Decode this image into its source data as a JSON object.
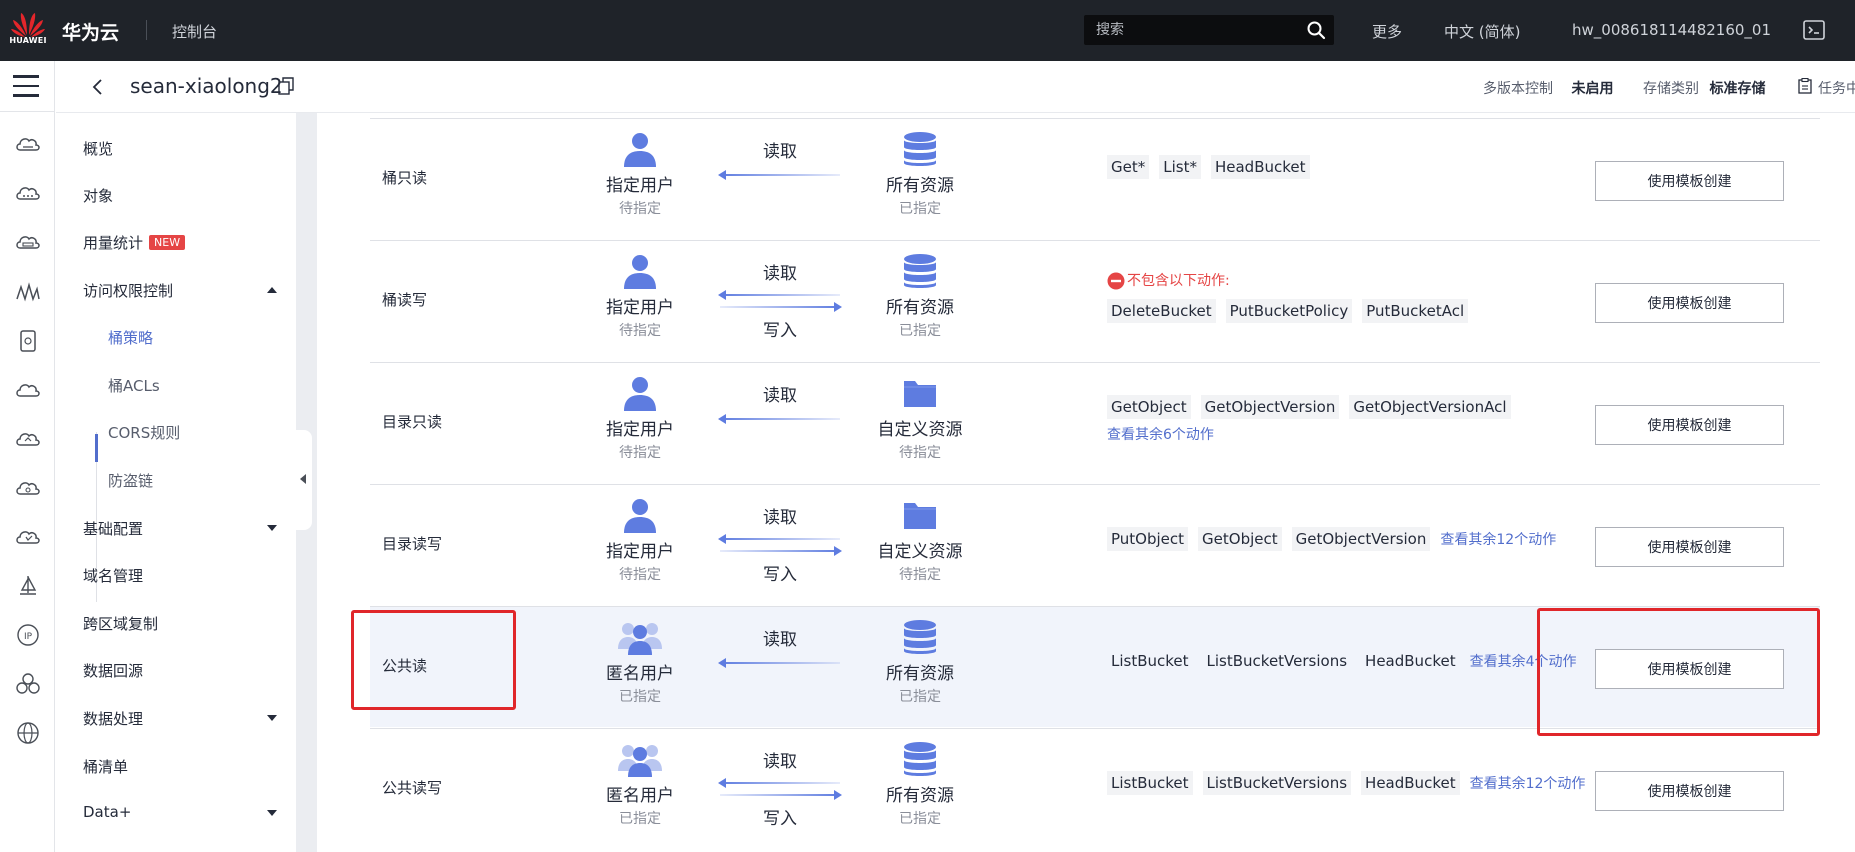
{
  "topbar": {
    "logo_text": "HUAWEI",
    "brand": "华为云",
    "console": "控制台",
    "search_placeholder": "搜索",
    "more": "更多",
    "language": "中文 (简体)",
    "account": "hw_008618114482160_01"
  },
  "header": {
    "bucket_name": "sean-xiaolong2",
    "versioning_label": "多版本控制",
    "versioning_value": "未启用",
    "storage_label": "存储类别",
    "storage_value": "标准存储",
    "task_label": "任务中"
  },
  "nav": {
    "overview": "概览",
    "objects": "对象",
    "usage": "用量统计",
    "usage_badge": "NEW",
    "access_control": "访问权限控制",
    "bucket_policy": "桶策略",
    "bucket_acls": "桶ACLs",
    "cors": "CORS规则",
    "hotlink": "防盗链",
    "basic_config": "基础配置",
    "domain": "域名管理",
    "cross_region": "跨区域复制",
    "back_to_source": "数据回源",
    "data_processing": "数据处理",
    "inventory": "桶清单",
    "data_plus": "Data+"
  },
  "rows": [
    {
      "name": "桶只读",
      "principal": "指定用户",
      "principal_status": "待指定",
      "read_label": "读取",
      "write_label": "",
      "resource": "所有资源",
      "resource_status": "已指定",
      "exclude_text": "",
      "tags": [
        "Get*",
        "List*",
        "HeadBucket"
      ],
      "more": "",
      "button": "使用模板创建"
    },
    {
      "name": "桶读写",
      "principal": "指定用户",
      "principal_status": "待指定",
      "read_label": "读取",
      "write_label": "写入",
      "resource": "所有资源",
      "resource_status": "已指定",
      "exclude_text": "不包含以下动作:",
      "tags": [
        "DeleteBucket",
        "PutBucketPolicy",
        "PutBucketAcl"
      ],
      "more": "",
      "button": "使用模板创建"
    },
    {
      "name": "目录只读",
      "principal": "指定用户",
      "principal_status": "待指定",
      "read_label": "读取",
      "write_label": "",
      "resource": "自定义资源",
      "resource_status": "待指定",
      "exclude_text": "",
      "tags": [
        "GetObject",
        "GetObjectVersion",
        "GetObjectVersionAcl"
      ],
      "more": "查看其余6个动作",
      "button": "使用模板创建"
    },
    {
      "name": "目录读写",
      "principal": "指定用户",
      "principal_status": "待指定",
      "read_label": "读取",
      "write_label": "写入",
      "resource": "自定义资源",
      "resource_status": "待指定",
      "exclude_text": "",
      "tags": [
        "PutObject",
        "GetObject",
        "GetObjectVersion"
      ],
      "more": "查看其余12个动作",
      "button": "使用模板创建"
    },
    {
      "name": "公共读",
      "principal": "匿名用户",
      "principal_status": "已指定",
      "read_label": "读取",
      "write_label": "",
      "resource": "所有资源",
      "resource_status": "已指定",
      "exclude_text": "",
      "tags": [
        "ListBucket",
        "ListBucketVersions",
        "HeadBucket"
      ],
      "more": "查看其余4个动作",
      "button": "使用模板创建"
    },
    {
      "name": "公共读写",
      "principal": "匿名用户",
      "principal_status": "已指定",
      "read_label": "读取",
      "write_label": "写入",
      "resource": "所有资源",
      "resource_status": "已指定",
      "exclude_text": "",
      "tags": [
        "ListBucket",
        "ListBucketVersions",
        "HeadBucket"
      ],
      "more": "查看其余12个动作",
      "button": "使用模板创建"
    }
  ],
  "colors": {
    "topbar": "#1f2329",
    "accent": "#526ecc",
    "icon_blue": "#5e7ce0",
    "highlight_row": "#f1f4fb",
    "annotation_red": "#e0262a"
  }
}
